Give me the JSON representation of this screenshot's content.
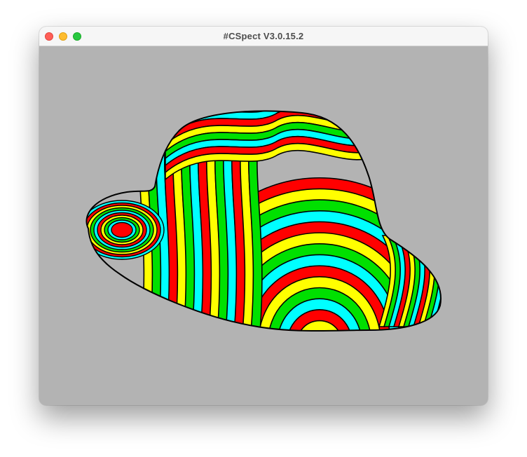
{
  "window": {
    "title": "#CSpect V3.0.15.2",
    "controls": [
      {
        "name": "close",
        "color": "#ff5f57"
      },
      {
        "name": "minimize",
        "color": "#febc2e"
      },
      {
        "name": "zoom",
        "color": "#28c840"
      }
    ]
  },
  "emulator": {
    "background_color": "#b3b3b3",
    "scene": "striped hat rendered in screen buffer",
    "stripe_colors": [
      "#ff0000",
      "#ffff00",
      "#00e000",
      "#00ffff"
    ],
    "outline_color": "#000000"
  }
}
